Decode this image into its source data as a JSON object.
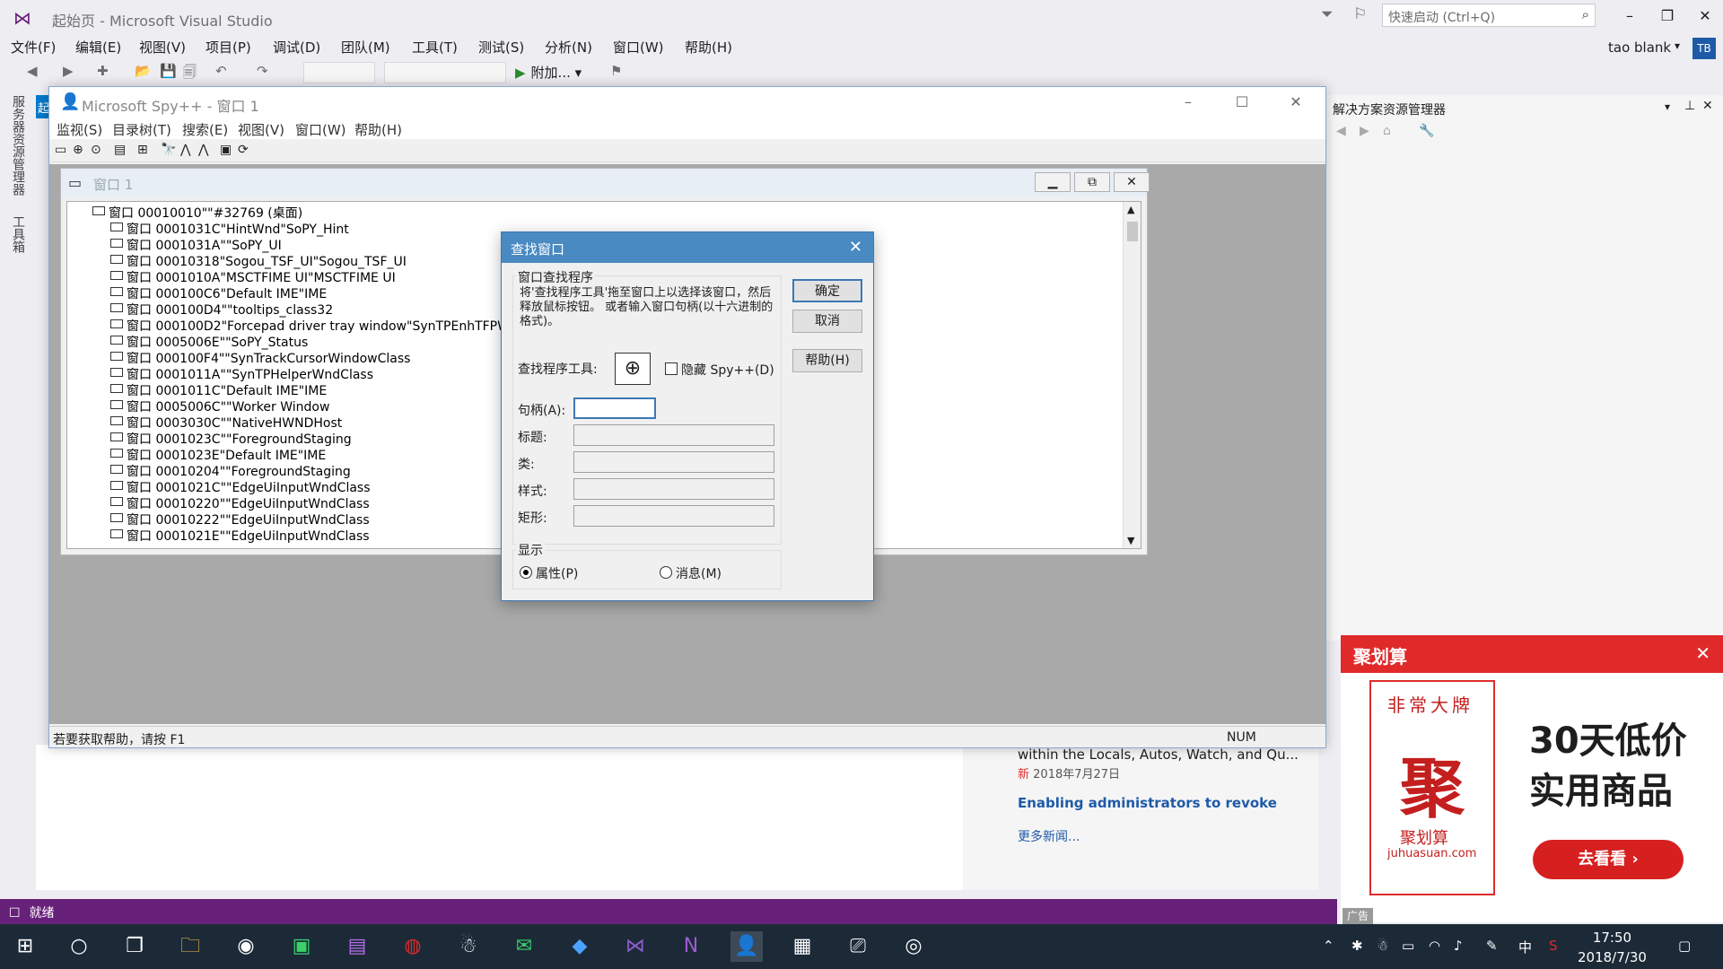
{
  "vs": {
    "title": "起始页 - Microsoft Visual Studio",
    "quick_launch": "快速启动 (Ctrl+Q)",
    "menu": [
      "文件(F)",
      "编辑(E)",
      "视图(V)",
      "项目(P)",
      "调试(D)",
      "团队(M)",
      "工具(T)",
      "测试(S)",
      "分析(N)",
      "窗口(W)",
      "帮助(H)"
    ],
    "user": "tao blank",
    "avatar": "TB",
    "attach": "附加...",
    "rail_tabs": [
      "服务器资源管理器",
      "工具箱"
    ],
    "solution_explorer": "解决方案资源管理器",
    "status": "就绪",
    "news": {
      "line1": "within the Locals, Autos, Watch, and Qu...",
      "new_tag": "新",
      "date": "2018年7月27日",
      "headline": "Enabling administrators to revoke",
      "more": "更多新闻..."
    },
    "start_tab": "起"
  },
  "ad": {
    "title": "聚划算",
    "card_top": "非常大牌",
    "card_big": "聚",
    "card_brand": "聚划算",
    "card_url": "juhuasuan.com",
    "slogan1": "30天低价",
    "slogan2": "实用商品",
    "button": "去看看 ›",
    "tag": "广告"
  },
  "spy": {
    "title": "Microsoft Spy++ - 窗口 1",
    "menu": [
      "监视(S)",
      "目录树(T)",
      "搜索(E)",
      "视图(V)",
      "窗口(W)",
      "帮助(H)"
    ],
    "child_title": "窗口 1",
    "status_help": "若要获取帮助，请按 F1",
    "status_num": "NUM",
    "tree": [
      "窗口 00010010\"\"#32769 (桌面)",
      "窗口 0001031C\"HintWnd\"SoPY_Hint",
      "窗口 0001031A\"\"SoPY_UI",
      "窗口 00010318\"Sogou_TSF_UI\"Sogou_TSF_UI",
      "窗口 0001010A\"MSCTFIME UI\"MSCTFIME UI",
      "窗口 000100C6\"Default IME\"IME",
      "窗口 000100D4\"\"tooltips_class32",
      "窗口 000100D2\"Forcepad driver tray window\"SynTPEnhTFPWndClass",
      "窗口 0005006E\"\"SoPY_Status",
      "窗口 000100F4\"\"SynTrackCursorWindowClass",
      "窗口 0001011A\"\"SynTPHelperWndClass",
      "窗口 0001011C\"Default IME\"IME",
      "窗口 0005006C\"\"Worker Window",
      "窗口 0003030C\"\"NativeHWNDHost",
      "窗口 0001023C\"\"ForegroundStaging",
      "窗口 0001023E\"Default IME\"IME",
      "窗口 00010204\"\"ForegroundStaging",
      "窗口 0001021C\"\"EdgeUiInputWndClass",
      "窗口 00010220\"\"EdgeUiInputWndClass",
      "窗口 00010222\"\"EdgeUiInputWndClass",
      "窗口 0001021E\"\"EdgeUiInputWndClass"
    ]
  },
  "dialog": {
    "title": "查找窗口",
    "group_finder": "窗口查找程序",
    "description": "将'查找程序工具'拖至窗口上以选择该窗口，然后释放鼠标按钮。 或者输入窗口句柄(以十六进制的格式)。",
    "finder_label": "查找程序工具:",
    "hide_spy": "隐藏 Spy++(D)",
    "handle_label": "句柄(A):",
    "title_label": "标题:",
    "class_label": "类:",
    "style_label": "样式:",
    "rect_label": "矩形:",
    "group_show": "显示",
    "radio_props": "属性(P)",
    "radio_msgs": "消息(M)",
    "ok": "确定",
    "cancel": "取消",
    "help": "帮助(H)"
  },
  "taskbar": {
    "time": "17:50",
    "date": "2018/7/30",
    "ime": "中"
  }
}
